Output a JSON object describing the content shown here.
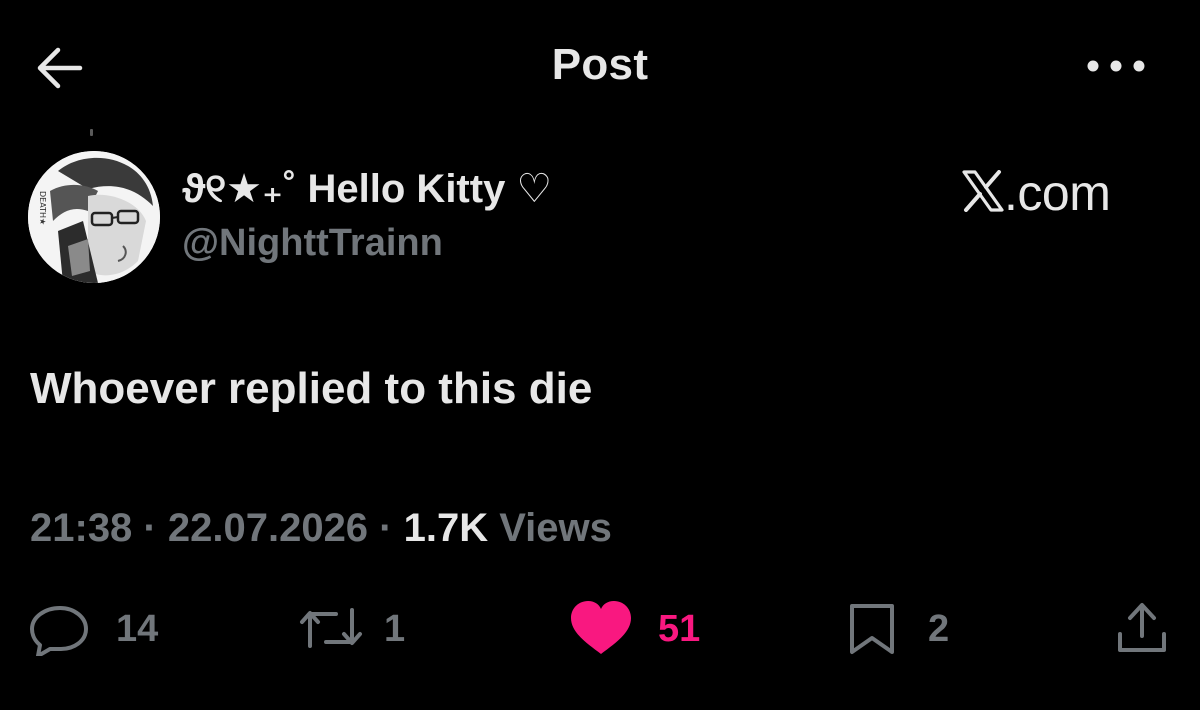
{
  "header": {
    "title": "Post",
    "back_icon": "arrow-left-icon",
    "more_icon": "more-horizontal-icon"
  },
  "author": {
    "display_name": "ϑ୧★₊˚ Hello Kitty ♡",
    "handle": "@NighttTrainn",
    "avatar_label": "DEATH★"
  },
  "brand": {
    "text": ".com",
    "logo_icon": "x-logo-icon"
  },
  "post": {
    "text": "Whoever replied to this die"
  },
  "meta": {
    "time": "21:38",
    "sep1": " · ",
    "date": "22.07.2026",
    "sep2": " · ",
    "views_count": "1.7K",
    "views_label": " Views"
  },
  "actions": {
    "reply_count": "14",
    "repost_count": "1",
    "like_count": "51",
    "bookmark_count": "2"
  },
  "colors": {
    "background": "#000000",
    "text_primary": "#e7e7e7",
    "text_secondary": "#71767b",
    "like": "#f91880"
  }
}
